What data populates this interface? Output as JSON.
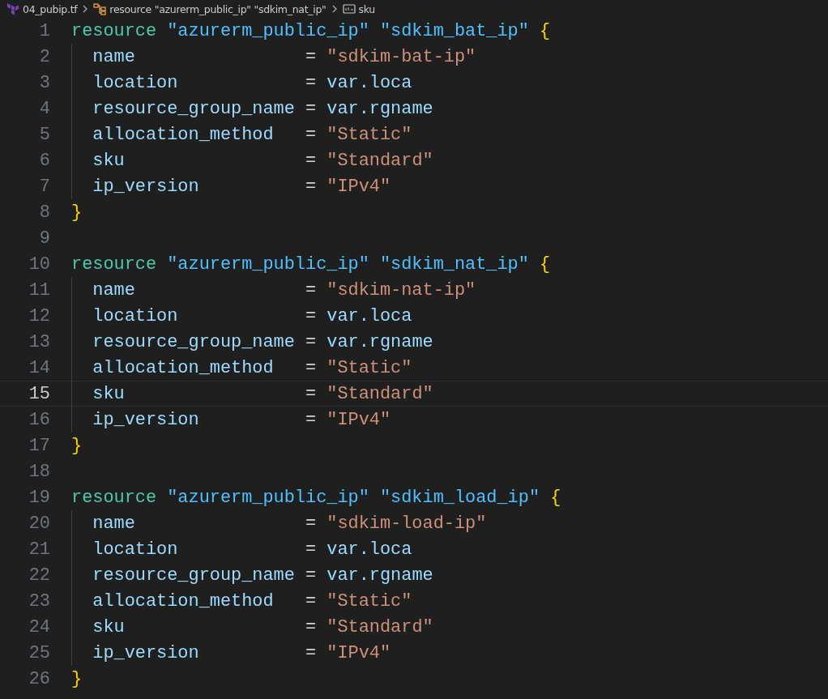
{
  "breadcrumb": {
    "file": "04_pubip.tf",
    "symbol": "resource \"azurerm_public_ip\" \"sdkim_nat_ip\"",
    "property": "sku"
  },
  "lines": [
    {
      "number": "1",
      "selected": false,
      "tokens": [
        {
          "kind": "keyword",
          "text": "resource "
        },
        {
          "kind": "type",
          "text": "\"azurerm_public_ip\" \"sdkim_bat_ip\" "
        },
        {
          "kind": "brace",
          "text": "{"
        }
      ]
    },
    {
      "number": "2",
      "selected": false,
      "indent": true,
      "tokens": [
        {
          "kind": "property",
          "text": "name"
        },
        {
          "kind": "operator",
          "text": "                = "
        },
        {
          "kind": "string",
          "text": "\"sdkim-bat-ip\""
        }
      ]
    },
    {
      "number": "3",
      "selected": false,
      "indent": true,
      "tokens": [
        {
          "kind": "property",
          "text": "location"
        },
        {
          "kind": "operator",
          "text": "            = "
        },
        {
          "kind": "variable",
          "text": "var.loca"
        }
      ]
    },
    {
      "number": "4",
      "selected": false,
      "indent": true,
      "tokens": [
        {
          "kind": "property",
          "text": "resource_group_name"
        },
        {
          "kind": "operator",
          "text": " = "
        },
        {
          "kind": "variable",
          "text": "var.rgname"
        }
      ]
    },
    {
      "number": "5",
      "selected": false,
      "indent": true,
      "tokens": [
        {
          "kind": "property",
          "text": "allocation_method"
        },
        {
          "kind": "operator",
          "text": "   = "
        },
        {
          "kind": "string",
          "text": "\"Static\""
        }
      ]
    },
    {
      "number": "6",
      "selected": false,
      "indent": true,
      "tokens": [
        {
          "kind": "property",
          "text": "sku"
        },
        {
          "kind": "operator",
          "text": "                 = "
        },
        {
          "kind": "string",
          "text": "\"Standard\""
        }
      ]
    },
    {
      "number": "7",
      "selected": false,
      "indent": true,
      "tokens": [
        {
          "kind": "property",
          "text": "ip_version"
        },
        {
          "kind": "operator",
          "text": "          = "
        },
        {
          "kind": "string",
          "text": "\"IPv4\""
        }
      ]
    },
    {
      "number": "8",
      "selected": false,
      "tokens": [
        {
          "kind": "brace",
          "text": "}"
        }
      ]
    },
    {
      "number": "9",
      "selected": false
    },
    {
      "number": "10",
      "selected": false,
      "tokens": [
        {
          "kind": "keyword",
          "text": "resource "
        },
        {
          "kind": "type",
          "text": "\"azurerm_public_ip\" \"sdkim_nat_ip\" "
        },
        {
          "kind": "brace",
          "text": "{"
        }
      ]
    },
    {
      "number": "11",
      "selected": false,
      "indent": true,
      "tokens": [
        {
          "kind": "property",
          "text": "name"
        },
        {
          "kind": "operator",
          "text": "                = "
        },
        {
          "kind": "string",
          "text": "\"sdkim-nat-ip\""
        }
      ]
    },
    {
      "number": "12",
      "selected": false,
      "indent": true,
      "tokens": [
        {
          "kind": "property",
          "text": "location"
        },
        {
          "kind": "operator",
          "text": "            = "
        },
        {
          "kind": "variable",
          "text": "var.loca"
        }
      ]
    },
    {
      "number": "13",
      "selected": false,
      "indent": true,
      "tokens": [
        {
          "kind": "property",
          "text": "resource_group_name"
        },
        {
          "kind": "operator",
          "text": " = "
        },
        {
          "kind": "variable",
          "text": "var.rgname"
        }
      ]
    },
    {
      "number": "14",
      "selected": false,
      "indent": true,
      "tokens": [
        {
          "kind": "property",
          "text": "allocation_method"
        },
        {
          "kind": "operator",
          "text": "   = "
        },
        {
          "kind": "string",
          "text": "\"Static\""
        }
      ]
    },
    {
      "number": "15",
      "selected": true,
      "indent": true,
      "tokens": [
        {
          "kind": "property",
          "text": "sku"
        },
        {
          "kind": "operator",
          "text": "                 = "
        },
        {
          "kind": "string",
          "text": "\"Standard\""
        }
      ]
    },
    {
      "number": "16",
      "selected": false,
      "indent": true,
      "tokens": [
        {
          "kind": "property",
          "text": "ip_version"
        },
        {
          "kind": "operator",
          "text": "          = "
        },
        {
          "kind": "string",
          "text": "\"IPv4\""
        }
      ]
    },
    {
      "number": "17",
      "selected": false,
      "tokens": [
        {
          "kind": "brace",
          "text": "}"
        }
      ]
    },
    {
      "number": "18",
      "selected": false
    },
    {
      "number": "19",
      "selected": false,
      "tokens": [
        {
          "kind": "keyword",
          "text": "resource "
        },
        {
          "kind": "type",
          "text": "\"azurerm_public_ip\" \"sdkim_load_ip\" "
        },
        {
          "kind": "brace",
          "text": "{"
        }
      ]
    },
    {
      "number": "20",
      "selected": false,
      "indent": true,
      "tokens": [
        {
          "kind": "property",
          "text": "name"
        },
        {
          "kind": "operator",
          "text": "                = "
        },
        {
          "kind": "string",
          "text": "\"sdkim-load-ip\""
        }
      ]
    },
    {
      "number": "21",
      "selected": false,
      "indent": true,
      "tokens": [
        {
          "kind": "property",
          "text": "location"
        },
        {
          "kind": "operator",
          "text": "            = "
        },
        {
          "kind": "variable",
          "text": "var.loca"
        }
      ]
    },
    {
      "number": "22",
      "selected": false,
      "indent": true,
      "tokens": [
        {
          "kind": "property",
          "text": "resource_group_name"
        },
        {
          "kind": "operator",
          "text": " = "
        },
        {
          "kind": "variable",
          "text": "var.rgname"
        }
      ]
    },
    {
      "number": "23",
      "selected": false,
      "indent": true,
      "tokens": [
        {
          "kind": "property",
          "text": "allocation_method"
        },
        {
          "kind": "operator",
          "text": "   = "
        },
        {
          "kind": "string",
          "text": "\"Static\""
        }
      ]
    },
    {
      "number": "24",
      "selected": false,
      "indent": true,
      "tokens": [
        {
          "kind": "property",
          "text": "sku"
        },
        {
          "kind": "operator",
          "text": "                 = "
        },
        {
          "kind": "string",
          "text": "\"Standard\""
        }
      ]
    },
    {
      "number": "25",
      "selected": false,
      "indent": true,
      "tokens": [
        {
          "kind": "property",
          "text": "ip_version"
        },
        {
          "kind": "operator",
          "text": "          = "
        },
        {
          "kind": "string",
          "text": "\"IPv4\""
        }
      ]
    },
    {
      "number": "26",
      "selected": false,
      "tokens": [
        {
          "kind": "brace",
          "text": "}"
        }
      ]
    }
  ]
}
